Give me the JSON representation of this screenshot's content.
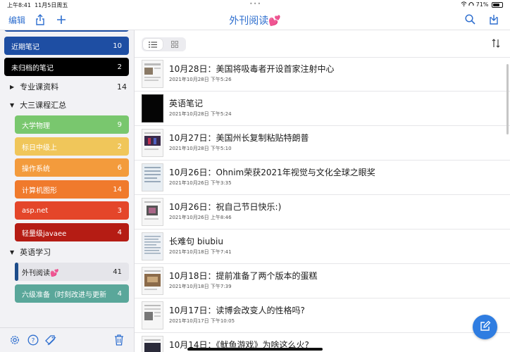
{
  "status": {
    "time": "上午8:41",
    "date": "11月5日周五",
    "battery": "71%"
  },
  "nav": {
    "edit_label": "编辑",
    "title": "外刊阅读💕"
  },
  "sidebar": {
    "top_items": [
      {
        "label": "近期笔记",
        "count": "10",
        "color": "#1e4ea3"
      },
      {
        "label": "未归档的笔记",
        "count": "2",
        "color": "#000000"
      }
    ],
    "group_zhuanye": {
      "label": "专业课资料",
      "count": "14"
    },
    "group_dasan": {
      "label": "大三课程汇总"
    },
    "dasan_items": [
      {
        "label": "大学物理",
        "count": "9",
        "color": "#79c76e"
      },
      {
        "label": "标日中级上",
        "count": "2",
        "color": "#f0c65a"
      },
      {
        "label": "操作系统",
        "count": "6",
        "color": "#f39b3c"
      },
      {
        "label": "计算机图形",
        "count": "14",
        "color": "#f07a2c"
      },
      {
        "label": "asp.net",
        "count": "3",
        "color": "#e4462a"
      },
      {
        "label": "轻量级javaee",
        "count": "4",
        "color": "#b51c14"
      }
    ],
    "group_yingyu": {
      "label": "英语学习"
    },
    "yingyu_items": [
      {
        "label": "外刊阅读💕",
        "count": "41"
      },
      {
        "label": "六级准备（时刻改进与更新",
        "count": "4",
        "color": "#5aa79a"
      }
    ]
  },
  "notes": [
    {
      "title": "10月28日：美国将吸毒者开设首家注射中心",
      "date": "2021年10月28日 下午5:26"
    },
    {
      "title": "英语笔记",
      "date": "2021年10月28日 下午5:24"
    },
    {
      "title": "10月27日：美国州长复制粘贴特朗普",
      "date": "2021年10月28日 下午5:10"
    },
    {
      "title": "10月26日：Ohnim荣获2021年视觉与文化全球之眼奖",
      "date": "2021年10月26日 下午3:35"
    },
    {
      "title": "10月26日：祝自己节日快乐:)",
      "date": "2021年10月26日 上午8:46"
    },
    {
      "title": "长难句 biubiu",
      "date": "2021年10月18日 下午7:41"
    },
    {
      "title": "10月18日：提前准备了两个版本的蛋糕",
      "date": "2021年10月18日 下午7:39"
    },
    {
      "title": "10月17日：读博会改变人的性格吗?",
      "date": "2021年10月17日 下午10:05"
    },
    {
      "title": "10月14日：《鱿鱼游戏》为啥这么火?",
      "date": ""
    }
  ],
  "colors": {
    "accent": "#2f6fcf",
    "fab": "#2f7de1"
  }
}
